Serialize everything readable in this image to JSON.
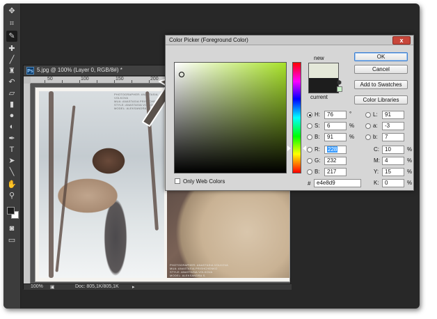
{
  "document": {
    "title": "5.jpg @ 100% (Layer 0, RGB/8#) *",
    "ps_badge": "Ps",
    "ruler_ticks": [
      "50",
      "100",
      "150",
      "200",
      "250"
    ],
    "zoom": "100%",
    "doc_info": "Doc: 805,1K/805,1K",
    "photo_credit_lines": [
      "PHOTOGRAPHER: ANASTASIA VOLKOVA",
      "MUA: ANASTASIA PRISHCHENKO",
      "STYLE: ANASTASIA VOLKOVA",
      "MODEL: ALEKSANDRA S."
    ]
  },
  "toolbar": {
    "icons": [
      "move-icon",
      "crop-icon",
      "eyedropper-icon",
      "healing-icon",
      "brush-icon",
      "clone-stamp-icon",
      "history-brush-icon",
      "eraser-icon",
      "gradient-icon",
      "blur-icon",
      "dodge-icon",
      "pen-icon",
      "type-icon",
      "path-select-icon",
      "shape-icon",
      "hand-icon",
      "zoom-icon"
    ],
    "foreground_color": "#1d1d1d",
    "background_color": "#ffffff"
  },
  "dialog": {
    "title": "Color Picker (Foreground Color)",
    "close_glyph": "x",
    "new_label": "new",
    "current_label": "current",
    "new_color": "#e4e8d9",
    "current_color": "#1d1d1d",
    "only_web_colors": "Only Web Colors",
    "buttons": {
      "ok": "OK",
      "cancel": "Cancel",
      "add_to_swatches": "Add to Swatches",
      "color_libraries": "Color Libraries"
    },
    "hsb": [
      {
        "label": "H:",
        "value": "76",
        "unit": "°",
        "selected": true
      },
      {
        "label": "S:",
        "value": "6",
        "unit": "%",
        "selected": false
      },
      {
        "label": "B:",
        "value": "91",
        "unit": "%",
        "selected": false
      }
    ],
    "rgb": [
      {
        "label": "R:",
        "value": "228",
        "unit": "",
        "selected": false
      },
      {
        "label": "G:",
        "value": "232",
        "unit": "",
        "selected": false
      },
      {
        "label": "B:",
        "value": "217",
        "unit": "",
        "selected": false
      }
    ],
    "lab": [
      {
        "label": "L:",
        "value": "91"
      },
      {
        "label": "a:",
        "value": "-3"
      },
      {
        "label": "b:",
        "value": "7"
      }
    ],
    "cmyk": [
      {
        "label": "C:",
        "value": "10",
        "unit": "%"
      },
      {
        "label": "M:",
        "value": "4",
        "unit": "%"
      },
      {
        "label": "Y:",
        "value": "15",
        "unit": "%"
      },
      {
        "label": "K:",
        "value": "0",
        "unit": "%"
      }
    ],
    "hex_label": "#",
    "hex_value": "e4e8d9"
  }
}
